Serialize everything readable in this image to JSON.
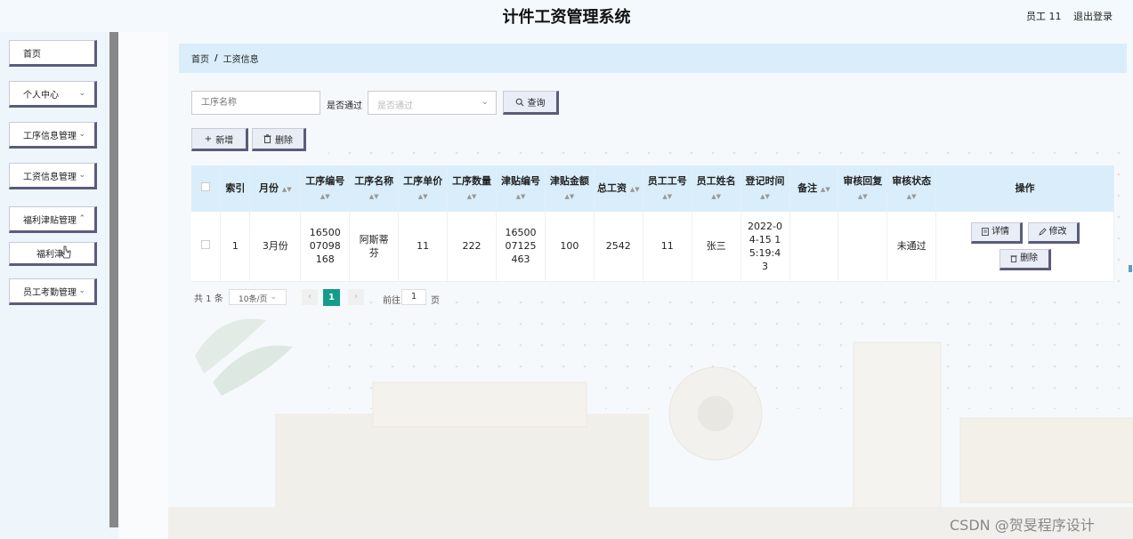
{
  "header": {
    "title": "计件工资管理系统",
    "user": "员工 11",
    "logout": "退出登录"
  },
  "sidebar": {
    "items": [
      {
        "label": "首页",
        "chevron": false
      },
      {
        "label": "个人中心",
        "chevron": true
      },
      {
        "label": "工序信息管理",
        "chevron": true
      },
      {
        "label": "工资信息管理",
        "chevron": true
      },
      {
        "label": "福利津贴管理",
        "chevron": true
      },
      {
        "label": "员工考勤管理",
        "chevron": true
      }
    ],
    "sub_item": "福利津"
  },
  "breadcrumb": {
    "home": "首页",
    "sep": "/",
    "current": "工资信息"
  },
  "search": {
    "name_placeholder": "工序名称",
    "pass_label": "是否通过",
    "pass_placeholder": "是否通过",
    "query_button": "查询"
  },
  "actions": {
    "add": "新增",
    "delete": "删除"
  },
  "table": {
    "headers": [
      "索引",
      "月份",
      "工序编号",
      "工序名称",
      "工序单价",
      "工序数量",
      "津贴编号",
      "津贴金额",
      "总工资",
      "员工工号",
      "员工姓名",
      "登记时间",
      "备注",
      "审核回复",
      "审核状态",
      "操作"
    ],
    "rows": [
      {
        "index": "1",
        "month": "3月份",
        "process_no": "1650007098168",
        "process_name": "阿斯蒂芬",
        "unit_price": "11",
        "quantity": "222",
        "allowance_no": "1650007125463",
        "allowance_amount": "100",
        "total_wage": "2542",
        "emp_no": "11",
        "emp_name": "张三",
        "reg_time": "2022-04-15 15:19:43",
        "remark": "",
        "review_reply": "",
        "review_status": "未通过",
        "op_detail": "详情",
        "op_edit": "修改",
        "op_delete": "删除"
      }
    ]
  },
  "pagination": {
    "total": "共 1 条",
    "page_size": "10条/页",
    "current_page": "1",
    "goto_label": "前往",
    "goto_value": "1",
    "unit": "页"
  },
  "watermark": "CSDN @贺旻程序设计",
  "colors": {
    "header_bg": "#d9eefa",
    "active_page": "#149c8a",
    "button_shadow": "#5b5c7a"
  }
}
